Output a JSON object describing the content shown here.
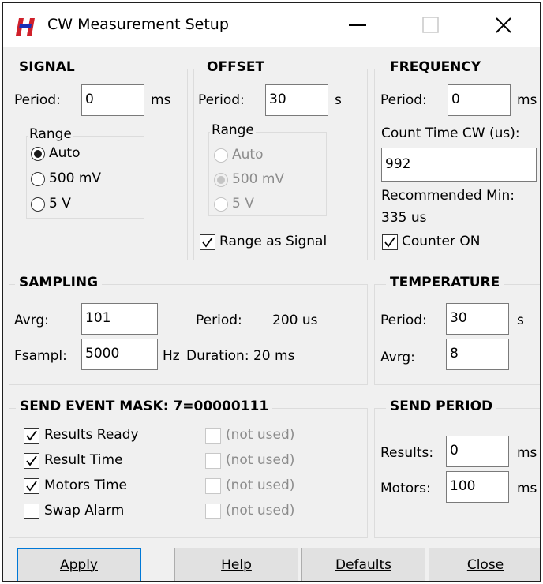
{
  "window": {
    "title": "CW Measurement Setup",
    "icon": "red-blue-H-logo-icon",
    "controls": [
      "minimize-icon",
      "maximize-icon",
      "close-icon"
    ]
  },
  "signal": {
    "title": "SIGNAL",
    "period_label": "Period:",
    "period_value": "0",
    "period_unit": "ms",
    "range_title": "Range",
    "range_options": [
      "Auto",
      "500 mV",
      "5 V"
    ],
    "range_selected": "Auto"
  },
  "offset": {
    "title": "OFFSET",
    "period_label": "Period:",
    "period_value": "30",
    "period_unit": "s",
    "range_title": "Range",
    "range_options": [
      "Auto",
      "500 mV",
      "5 V"
    ],
    "range_selected": "500 mV",
    "range_disabled": true,
    "range_as_signal_label": "Range as Signal",
    "range_as_signal_checked": true
  },
  "frequency": {
    "title": "FREQUENCY",
    "period_label": "Period:",
    "period_value": "0",
    "period_unit": "ms",
    "count_time_label": "Count Time CW (us):",
    "count_time_value": "992",
    "recommended_label": "Recommended Min:",
    "recommended_value": "335 us",
    "counter_label": "Counter ON",
    "counter_checked": true
  },
  "sampling": {
    "title": "SAMPLING",
    "avrg_label": "Avrg:",
    "avrg_value": "101",
    "period_label": "Period:",
    "period_value": "200 us",
    "fsampl_label": "Fsampl:",
    "fsampl_value": "5000",
    "fsampl_unit": "Hz",
    "duration_text": "Duration: 20 ms"
  },
  "temperature": {
    "title": "TEMPERATURE",
    "period_label": "Period:",
    "period_value": "30",
    "period_unit": "s",
    "avrg_label": "Avrg:",
    "avrg_value": "8"
  },
  "event_mask": {
    "title": "SEND EVENT MASK: 7=00000111",
    "items": [
      {
        "label": "Results Ready",
        "checked": true
      },
      {
        "label": "Result Time",
        "checked": true
      },
      {
        "label": "Motors Time",
        "checked": true
      },
      {
        "label": "Swap Alarm",
        "checked": false
      }
    ],
    "unused_items": [
      "(not used)",
      "(not used)",
      "(not used)",
      "(not used)"
    ]
  },
  "send_period": {
    "title": "SEND PERIOD",
    "results_label": "Results:",
    "results_value": "0",
    "results_unit": "ms",
    "motors_label": "Motors:",
    "motors_value": "100",
    "motors_unit": "ms"
  },
  "buttons": {
    "apply": "Apply",
    "help": "Help",
    "defaults": "Defaults",
    "close": "Close"
  }
}
